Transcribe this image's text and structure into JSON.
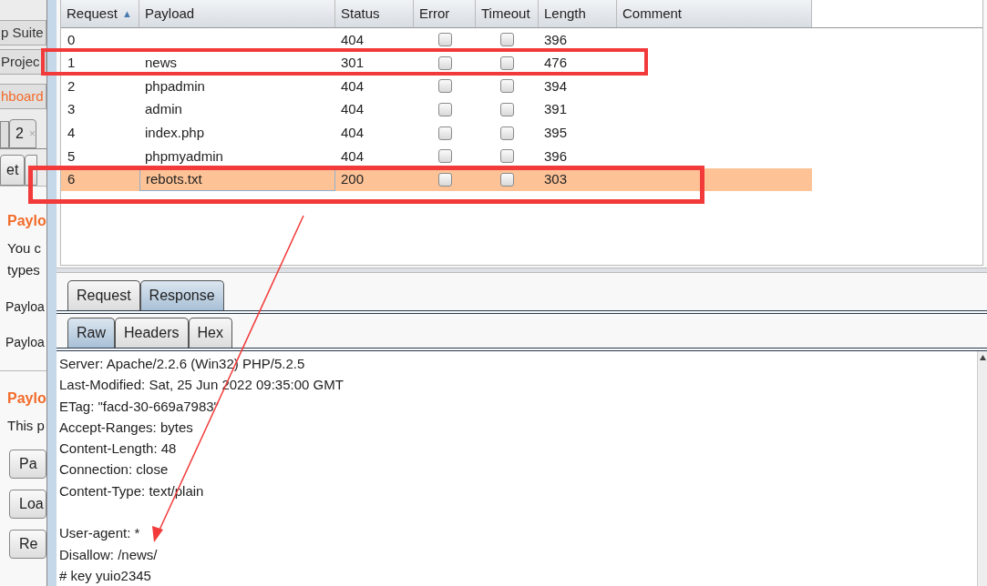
{
  "side_window": {
    "top_tabs": [
      {
        "label": "p Suite",
        "selected": false
      },
      {
        "label": "Projec",
        "selected": false
      },
      {
        "label": "hboard",
        "selected": true
      }
    ],
    "doc_tabs": [
      {
        "label": "2",
        "close": "×"
      }
    ],
    "sub_tabs": [
      {
        "label": "et"
      }
    ],
    "sections": [
      {
        "kind": "heading",
        "text": "Paylo"
      },
      {
        "kind": "text",
        "text": "You c"
      },
      {
        "kind": "text",
        "text": "types"
      },
      {
        "kind": "label",
        "text": "Payloa"
      },
      {
        "kind": "label",
        "text": "Payloa"
      },
      {
        "kind": "divider"
      },
      {
        "kind": "heading",
        "text": "Paylo"
      },
      {
        "kind": "text",
        "text": "This p"
      }
    ],
    "buttons": [
      "Pa",
      "Loa",
      "Re"
    ]
  },
  "table": {
    "columns": [
      {
        "label": "Request",
        "sort": "▲"
      },
      {
        "label": "Payload"
      },
      {
        "label": "Status"
      },
      {
        "label": "Error"
      },
      {
        "label": "Timeout"
      },
      {
        "label": "Length"
      },
      {
        "label": "Comment"
      }
    ],
    "rows": [
      {
        "request": "0",
        "payload": "",
        "status": "404",
        "error": false,
        "timeout": false,
        "length": "396",
        "selected": false
      },
      {
        "request": "1",
        "payload": "news",
        "status": "301",
        "error": false,
        "timeout": false,
        "length": "476",
        "selected": false
      },
      {
        "request": "2",
        "payload": "phpadmin",
        "status": "404",
        "error": false,
        "timeout": false,
        "length": "394",
        "selected": false
      },
      {
        "request": "3",
        "payload": "admin",
        "status": "404",
        "error": false,
        "timeout": false,
        "length": "391",
        "selected": false
      },
      {
        "request": "4",
        "payload": "index.php",
        "status": "404",
        "error": false,
        "timeout": false,
        "length": "395",
        "selected": false
      },
      {
        "request": "5",
        "payload": "phpmyadmin",
        "status": "404",
        "error": false,
        "timeout": false,
        "length": "396",
        "selected": false
      },
      {
        "request": "6",
        "payload": "rebots.txt",
        "status": "200",
        "error": false,
        "timeout": false,
        "length": "303",
        "selected": true
      }
    ]
  },
  "message_tabs": [
    {
      "label": "Request",
      "selected": false
    },
    {
      "label": "Response",
      "selected": true
    }
  ],
  "view_tabs": [
    {
      "label": "Raw",
      "selected": true
    },
    {
      "label": "Headers",
      "selected": false
    },
    {
      "label": "Hex",
      "selected": false
    }
  ],
  "response_lines": [
    "Server: Apache/2.2.6 (Win32) PHP/5.2.5",
    "Last-Modified: Sat, 25 Jun 2022 09:35:00 GMT",
    "ETag: \"facd-30-669a7983\"",
    "Accept-Ranges: bytes",
    "Content-Length: 48",
    "Connection: close",
    "Content-Type: text/plain"
  ],
  "response_body": [
    "User-agent: *",
    "Disallow: /news/",
    "# key yuio2345"
  ]
}
